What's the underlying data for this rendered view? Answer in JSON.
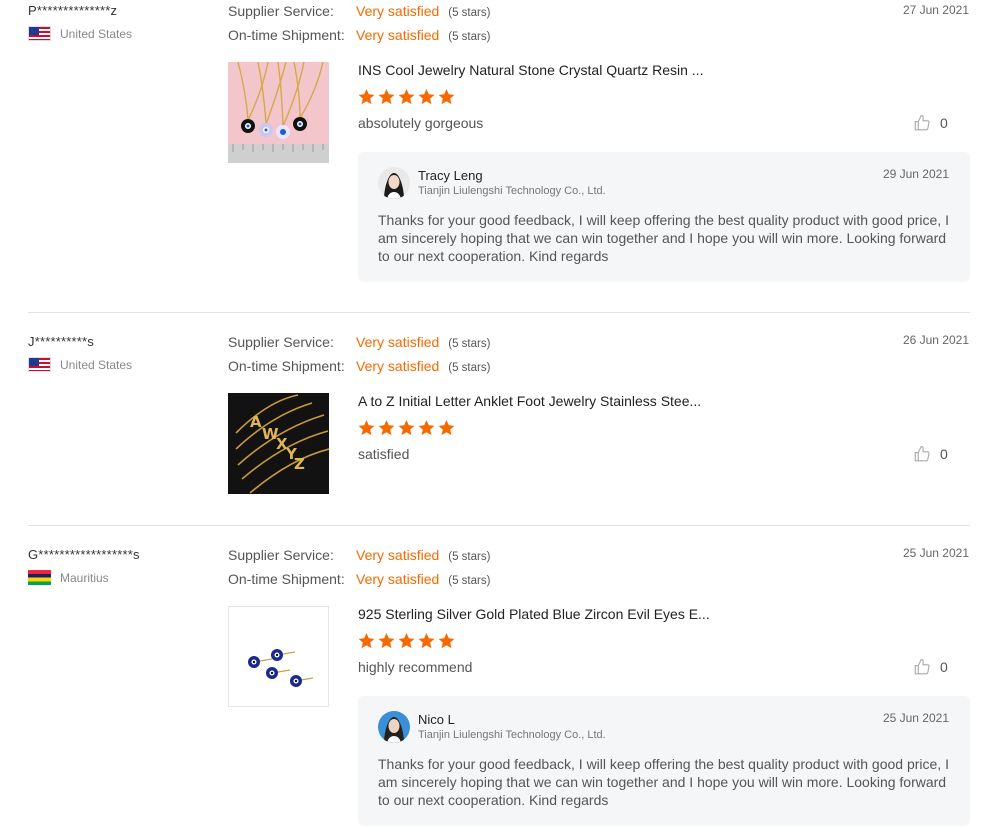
{
  "colors": {
    "accent": "#f56a00",
    "star": "#f56a00",
    "divider": "#e2e2e2",
    "reply_bg": "#f5f6f7"
  },
  "labels": {
    "supplier_service": "Supplier Service:",
    "ontime_shipment": "On-time Shipment:"
  },
  "reviews": [
    {
      "buyer": "P**************z",
      "country": "United States",
      "flag": "us-flag",
      "date": "27 Jun 2021",
      "supplier_service_value": "Very satisfied",
      "supplier_service_stars": "(5 stars)",
      "shipment_value": "Very satisfied",
      "shipment_stars": "(5 stars)",
      "product_title": "INS Cool Jewelry Natural Stone Crystal Quartz Resin ...",
      "product_image": "necklace-image",
      "rating": 5,
      "comment": "absolutely gorgeous",
      "helpful_count": "0",
      "reply": {
        "name": "Tracy Leng",
        "company": "Tianjin Liulengshi Technology Co., Ltd.",
        "date": "29 Jun 2021",
        "text": "Thanks for your good feedback, I will keep offering the best quality product with good price, I am sincerely hoping that we can win together and I hope you will win more. Looking forward to our next cooperation. Kind regards"
      }
    },
    {
      "buyer": "J**********s",
      "country": "United States",
      "flag": "us-flag",
      "date": "26 Jun 2021",
      "supplier_service_value": "Very satisfied",
      "supplier_service_stars": "(5 stars)",
      "shipment_value": "Very satisfied",
      "shipment_stars": "(5 stars)",
      "product_title": "A to Z Initial Letter Anklet Foot Jewelry Stainless Stee...",
      "product_image": "anklet-image",
      "rating": 5,
      "comment": "satisfied",
      "helpful_count": "0"
    },
    {
      "buyer": "G******************s",
      "country": "Mauritius",
      "flag": "mauritius-flag",
      "date": "25 Jun 2021",
      "supplier_service_value": "Very satisfied",
      "supplier_service_stars": "(5 stars)",
      "shipment_value": "Very satisfied",
      "shipment_stars": "(5 stars)",
      "product_title": "925 Sterling Silver Gold Plated Blue Zircon Evil Eyes E...",
      "product_image": "earrings-image",
      "rating": 5,
      "comment": "highly recommend",
      "helpful_count": "0",
      "reply": {
        "name": "Nico L",
        "company": "Tianjin Liulengshi Technology Co., Ltd.",
        "date": "25 Jun 2021",
        "text": "Thanks for your good feedback, I will keep offering the best quality product with good price, I am sincerely hoping that we can win together and I hope you will win more. Looking forward to our next cooperation. Kind regards"
      }
    }
  ]
}
